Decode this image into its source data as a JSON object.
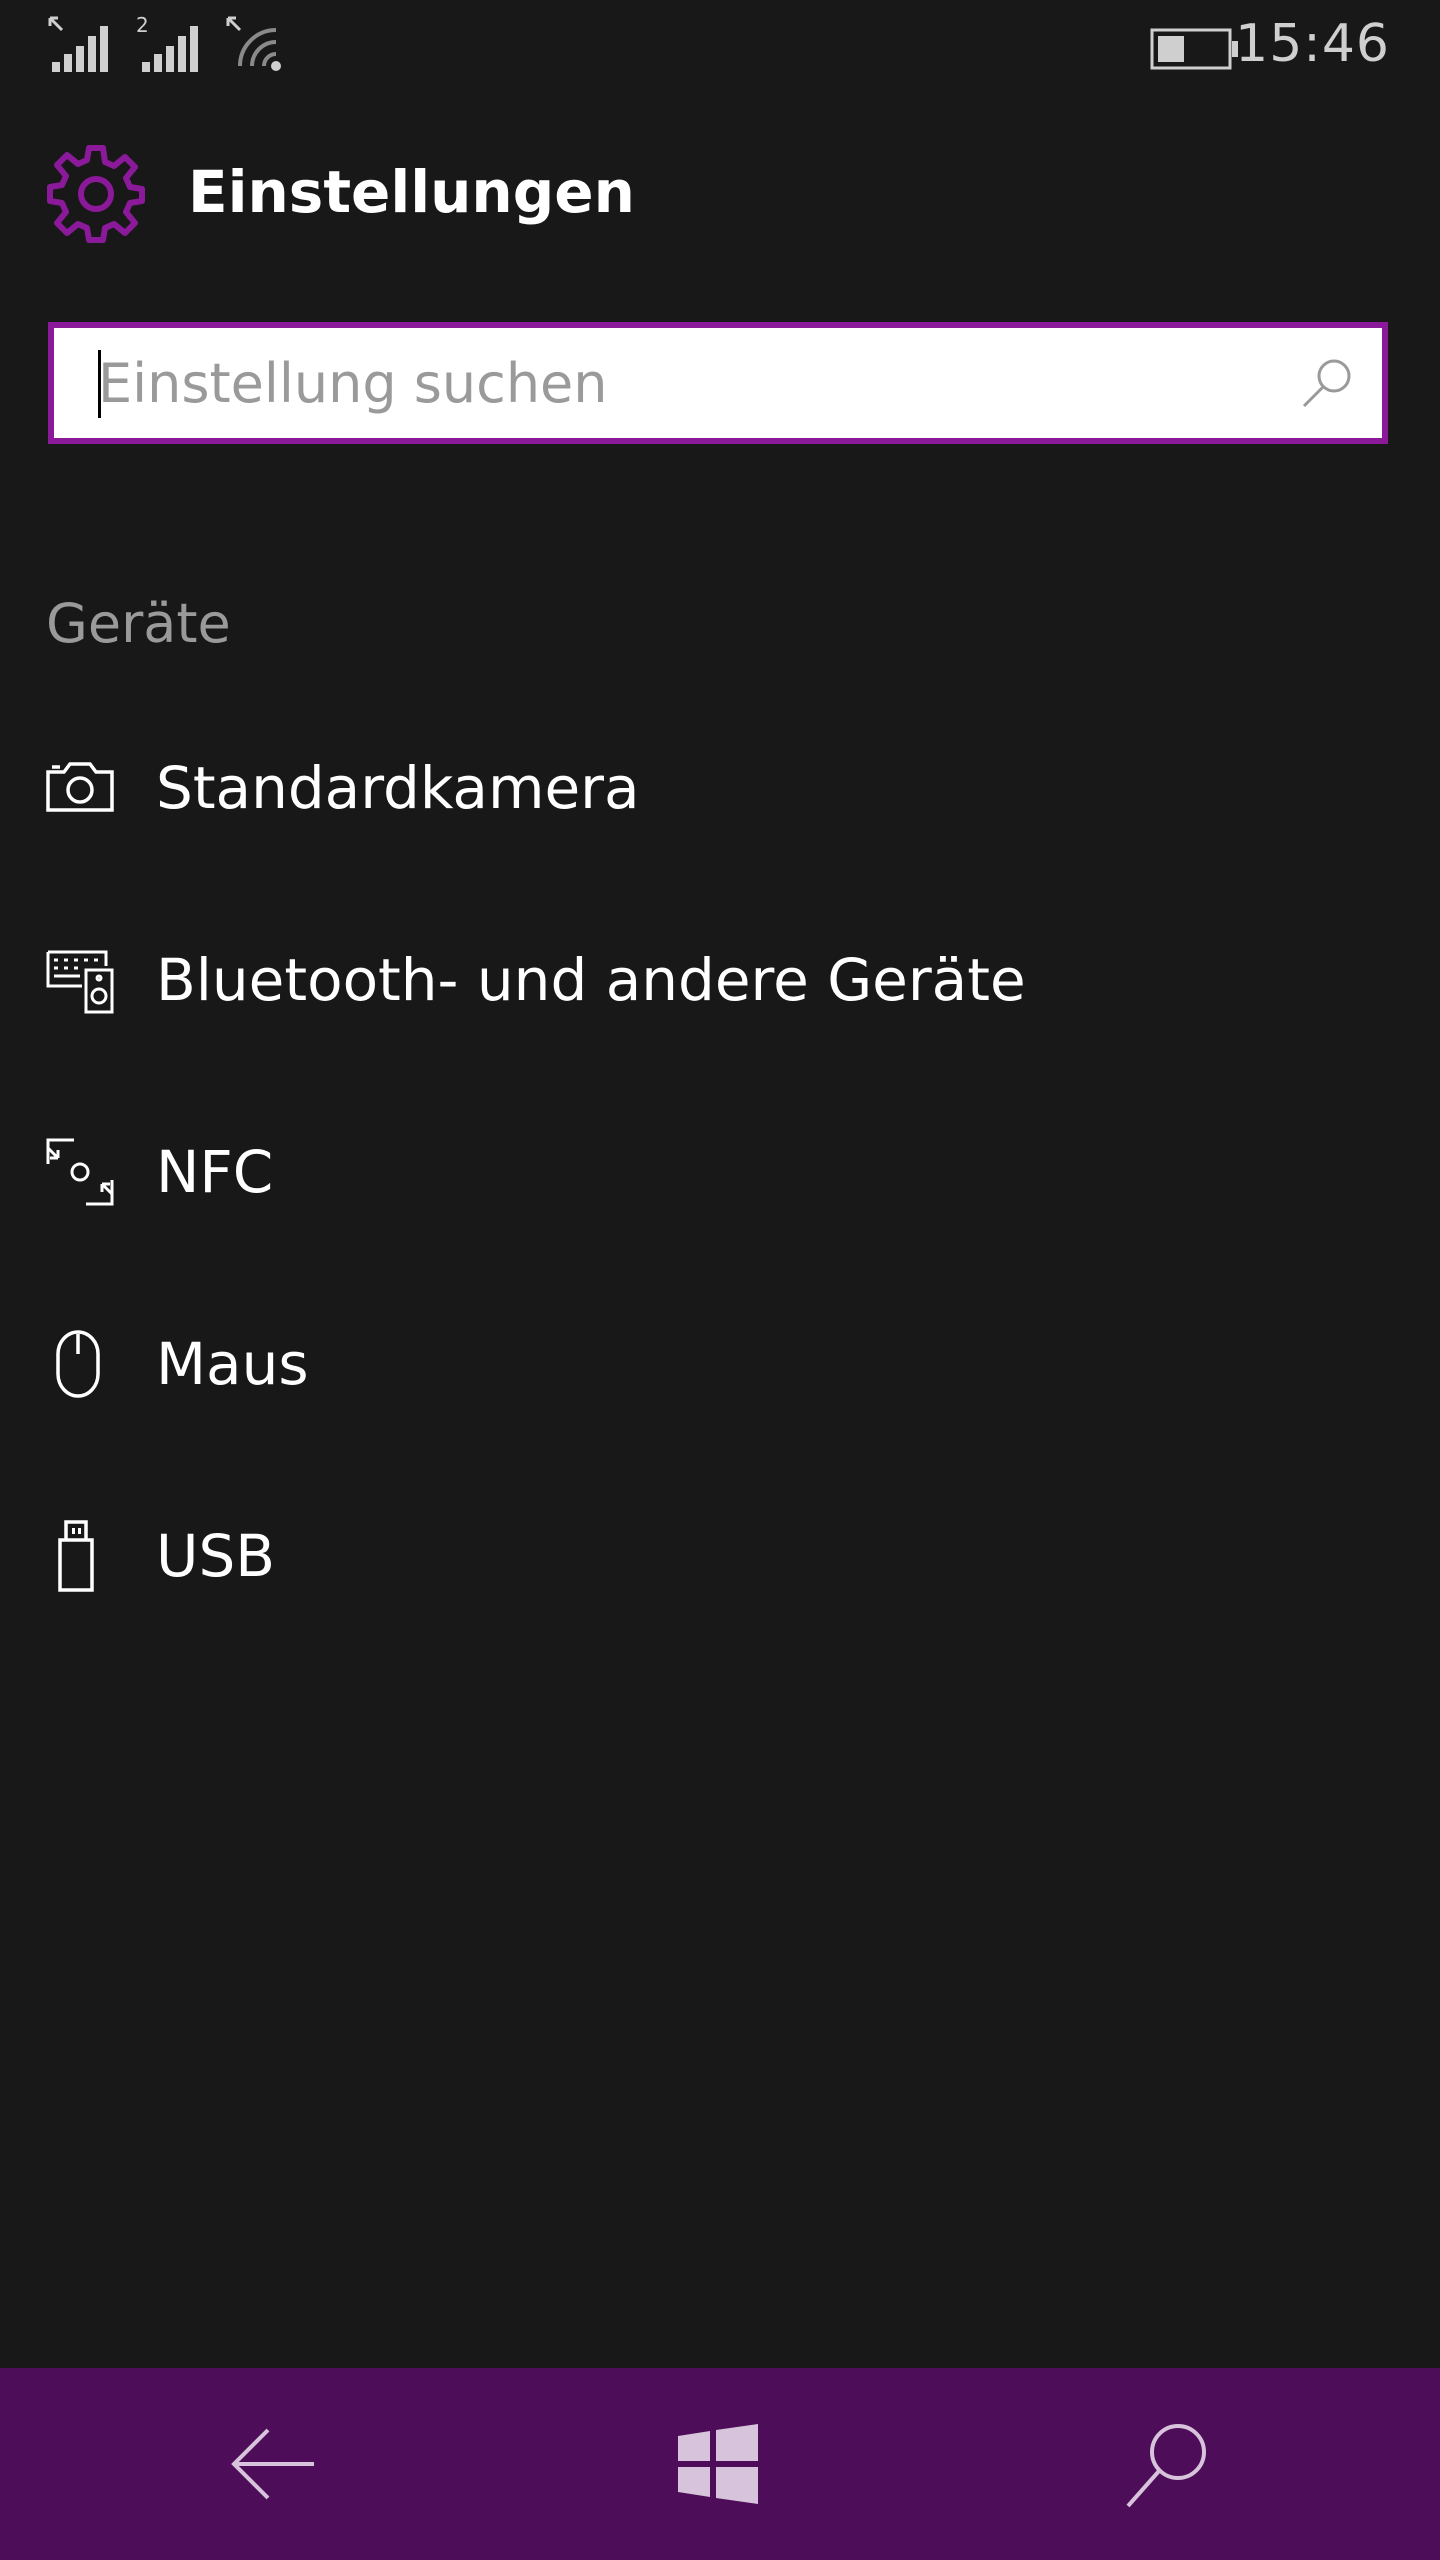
{
  "status_bar": {
    "sim2_label": "2",
    "time": "15:46",
    "battery_level": 0.4
  },
  "header": {
    "title": "Einstellungen"
  },
  "search": {
    "placeholder": "Einstellung suchen",
    "value": ""
  },
  "section": {
    "title": "Geräte",
    "items": [
      {
        "label": "Standardkamera",
        "icon": "camera-icon"
      },
      {
        "label": "Bluetooth- und andere Geräte",
        "icon": "bluetooth-devices-icon"
      },
      {
        "label": "NFC",
        "icon": "nfc-icon"
      },
      {
        "label": "Maus",
        "icon": "mouse-icon"
      },
      {
        "label": "USB",
        "icon": "usb-icon"
      }
    ]
  },
  "nav": {
    "buttons": [
      "back-arrow-icon",
      "windows-icon",
      "search-icon"
    ]
  },
  "colors": {
    "accent": "#8a1a9a",
    "background": "#181818",
    "nav_bar": "#4d0d58",
    "secondary_text": "#9a9a9a"
  }
}
